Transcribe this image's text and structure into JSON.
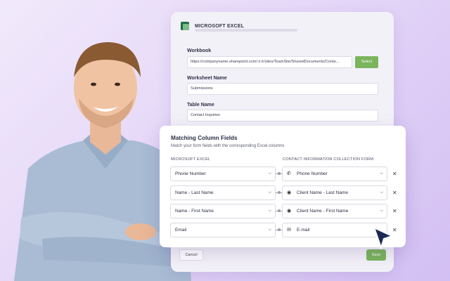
{
  "excel": {
    "app_title": "MICROSOFT EXCEL",
    "workbook_label": "Workbook",
    "workbook_value": "https://companyname.sharepoint.com/:x:/r/sites/TeamSite/SharedDocuments/Conta...",
    "select_label": "Select",
    "worksheet_label": "Worksheet Name",
    "worksheet_value": "Submissions",
    "table_label": "Table Name",
    "table_value": "Contact Inquiries",
    "cancel_label": "Cancel",
    "save_label": "Save"
  },
  "matching": {
    "title": "Matching Column Fields",
    "subtitle": "Match your form fields with the corresponding Excel columns",
    "left_header": "MICROSOFT EXCEL",
    "right_header": "CONTACT INFORMATION COLLECTION FORM",
    "rows": [
      {
        "excel": "Phone Number",
        "form": "Phone Number",
        "icon": "phone-icon"
      },
      {
        "excel": "Name - Last Name",
        "form": "Client Name - Last Name",
        "icon": "user-icon"
      },
      {
        "excel": "Name - First Name",
        "form": "Client Name - First Name",
        "icon": "user-icon"
      },
      {
        "excel": "Email",
        "form": "E-mail",
        "icon": "mail-icon"
      }
    ]
  },
  "colors": {
    "accent_green": "#7ab55c",
    "excel_green": "#1d6f42",
    "cursor": "#1b2a55"
  }
}
